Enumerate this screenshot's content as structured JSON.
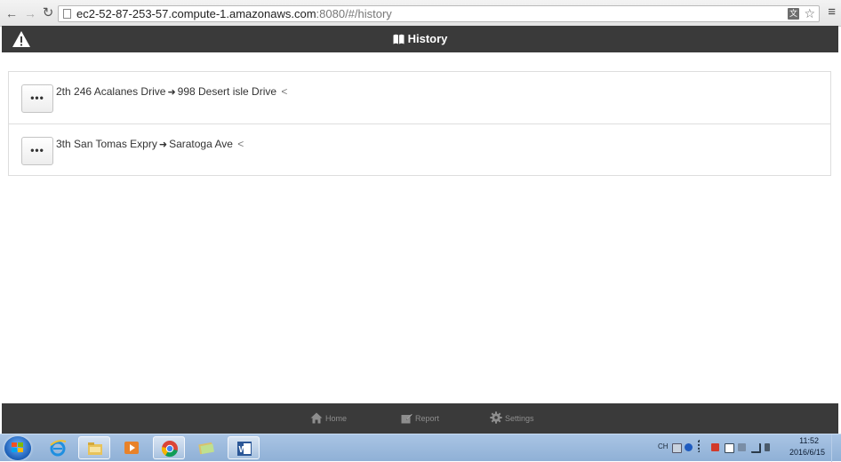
{
  "browser": {
    "url_host": "ec2-52-87-253-57.compute-1.amazonaws.com",
    "url_path": ":8080/#/history"
  },
  "header": {
    "title": "History"
  },
  "history": {
    "items": [
      {
        "more_label": "•••",
        "route_prefix": "2th",
        "from": "246 Acalanes Drive",
        "arrow": "➜",
        "to": "998 Desert isle Drive",
        "chevron": "<"
      },
      {
        "more_label": "•••",
        "route_prefix": "3th",
        "from": "San Tomas Expry",
        "arrow": "➜",
        "to": "Saratoga Ave",
        "chevron": "<"
      }
    ]
  },
  "tabs": {
    "home": "Home",
    "report": "Report",
    "settings": "Settings"
  },
  "taskbar": {
    "clock_time": "11:52",
    "clock_date": "2016/6/15",
    "language": "CH"
  },
  "colors": {
    "header_bg": "#3a3a3a",
    "tab_text": "#8e8e8e",
    "taskbar": "#9bb8dd"
  }
}
